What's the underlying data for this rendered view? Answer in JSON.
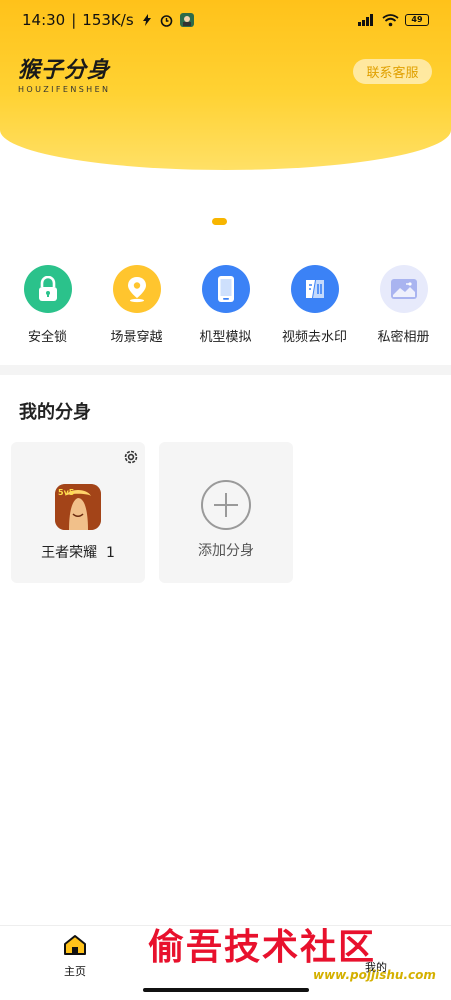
{
  "status_bar": {
    "time": "14:30",
    "speed": "153K/s",
    "battery": "49"
  },
  "brand": {
    "title": "猴子分身",
    "subtitle": "HOUZIFENSHEN"
  },
  "contact_button": "联系客服",
  "features": [
    {
      "label": "安全锁",
      "icon": "lock-icon",
      "color": "#2bc28b"
    },
    {
      "label": "场景穿越",
      "icon": "location-pin-icon",
      "color": "#ffc52e"
    },
    {
      "label": "机型模拟",
      "icon": "phone-icon",
      "color": "#3b82f6"
    },
    {
      "label": "视频去水印",
      "icon": "video-watermark-icon",
      "color": "#3b82f6"
    },
    {
      "label": "私密相册",
      "icon": "album-icon",
      "color": "#a9b4f0"
    }
  ],
  "section_title": "我的分身",
  "clones": [
    {
      "label": "王者荣耀  1",
      "icon": "game-app-icon"
    }
  ],
  "add_clone_label": "添加分身",
  "bottom_nav": {
    "home_label": "主页",
    "mine_label": "我的"
  },
  "watermark": {
    "text": "偷吾技术社区",
    "url": "www.pojjishu.com"
  },
  "colors": {
    "accent": "#ffc21a",
    "dot": "#f7b500"
  }
}
